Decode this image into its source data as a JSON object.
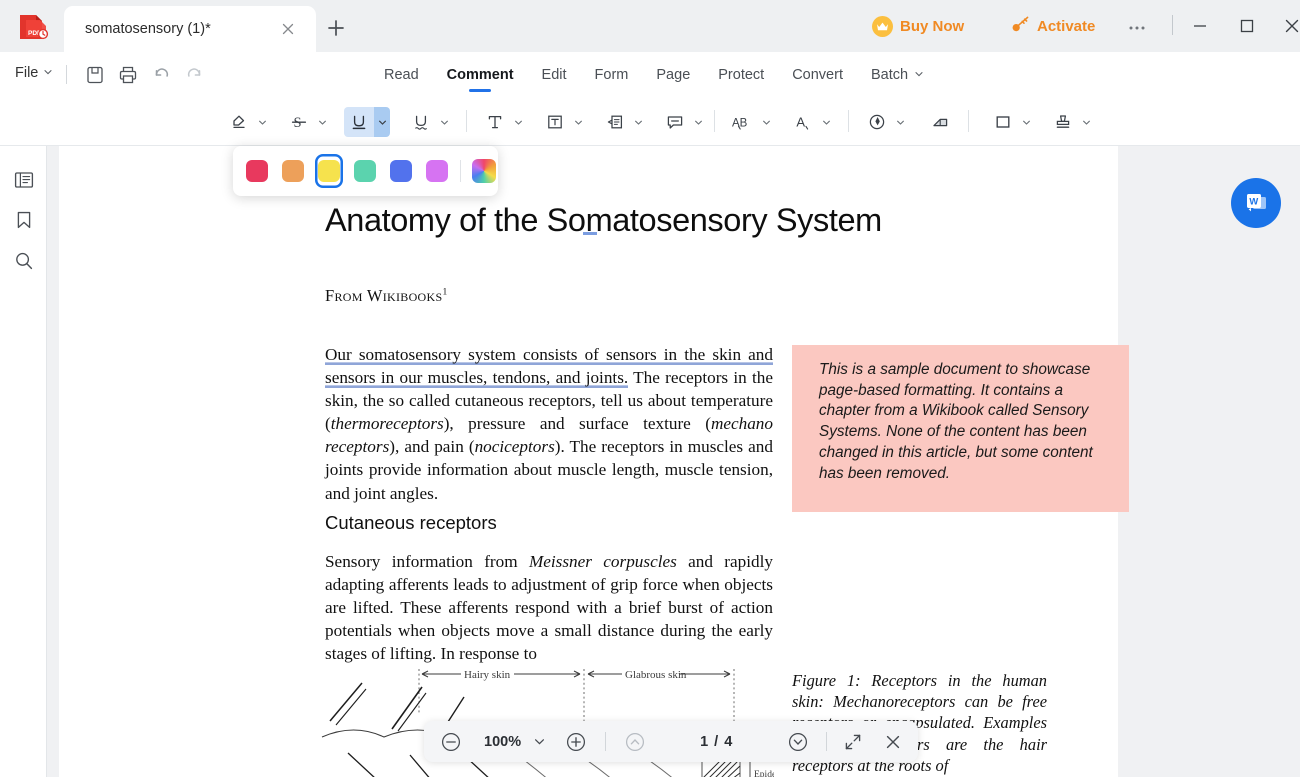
{
  "window": {
    "logo": "pdf-app-logo",
    "tab_title": "somatosensory (1)*",
    "close_tab_icon": "close-icon",
    "new_tab_icon": "plus-icon",
    "buy_now_label": "Buy Now",
    "buy_now_icon": "crown-icon",
    "activate_label": "Activate",
    "activate_icon": "key-icon",
    "more_icon": "ellipsis-icon",
    "minimize_icon": "minimize-icon",
    "maximize_icon": "maximize-icon",
    "close_icon": "close-icon",
    "accent_orange": "#f08a24",
    "accent_blue": "#2172e8"
  },
  "menubar": {
    "file_label": "File",
    "file_chevron": "chevron-down-icon",
    "quick_actions": [
      {
        "name": "save-icon",
        "title": "Save"
      },
      {
        "name": "print-icon",
        "title": "Print"
      },
      {
        "name": "undo-icon",
        "title": "Undo"
      },
      {
        "name": "redo-icon",
        "title": "Redo"
      }
    ],
    "tabs": [
      {
        "label": "Read",
        "active": false,
        "chevron": false
      },
      {
        "label": "Comment",
        "active": true,
        "chevron": false
      },
      {
        "label": "Edit",
        "active": false,
        "chevron": false
      },
      {
        "label": "Form",
        "active": false,
        "chevron": false
      },
      {
        "label": "Page",
        "active": false,
        "chevron": false
      },
      {
        "label": "Protect",
        "active": false,
        "chevron": false
      },
      {
        "label": "Convert",
        "active": false,
        "chevron": false
      },
      {
        "label": "Batch",
        "active": false,
        "chevron": true
      }
    ]
  },
  "toolbar": {
    "items": [
      {
        "name": "highlight-tool",
        "icon": "highlighter-icon",
        "chevron": true,
        "active": false
      },
      {
        "name": "strikethrough-tool",
        "icon": "strikethrough-icon",
        "chevron": true,
        "active": false
      },
      {
        "name": "underline-tool",
        "icon": "underline-icon",
        "chevron": true,
        "active": true
      },
      {
        "name": "squiggly-underline-tool",
        "icon": "squiggly-underline-icon",
        "chevron": true,
        "active": false
      },
      {
        "name": "text-tool",
        "icon": "text-T-icon",
        "chevron": true,
        "active": false
      },
      {
        "name": "text-box-tool",
        "icon": "text-box-icon",
        "chevron": true,
        "active": false
      },
      {
        "name": "callout-tool",
        "icon": "callout-icon",
        "chevron": true,
        "active": false
      },
      {
        "name": "note-tool",
        "icon": "sticky-note-icon",
        "chevron": true,
        "active": false
      },
      {
        "name": "replace-text-tool",
        "icon": "AB-replace-icon",
        "chevron": true,
        "active": false
      },
      {
        "name": "text-correction-tool",
        "icon": "A-correction-icon",
        "chevron": true,
        "active": false
      },
      {
        "name": "pencil-tool",
        "icon": "pen-circle-icon",
        "chevron": true,
        "active": false
      },
      {
        "name": "eraser-tool",
        "icon": "eraser-icon",
        "chevron": false,
        "active": false
      },
      {
        "name": "shape-tool",
        "icon": "rectangle-icon",
        "chevron": true,
        "active": false
      },
      {
        "name": "stamp-tool",
        "icon": "stamp-icon",
        "chevron": true,
        "active": false
      }
    ]
  },
  "color_popup": {
    "selected_index": 2,
    "swatches": [
      {
        "name": "color-red",
        "hex": "#e8395e"
      },
      {
        "name": "color-orange",
        "hex": "#eda05a"
      },
      {
        "name": "color-yellow",
        "hex": "#f6e24d"
      },
      {
        "name": "color-teal",
        "hex": "#5bd3ae"
      },
      {
        "name": "color-blue",
        "hex": "#5272ed"
      },
      {
        "name": "color-magenta",
        "hex": "#d673f2"
      }
    ],
    "more_colors_icon": "rainbow-color-picker-icon"
  },
  "left_rail": {
    "items": [
      {
        "name": "thumbnails-panel-icon",
        "title": "Thumbnails"
      },
      {
        "name": "bookmark-panel-icon",
        "title": "Bookmarks"
      },
      {
        "name": "search-panel-icon",
        "title": "Search"
      }
    ]
  },
  "document": {
    "title": "Anatomy of the Somatosensory System",
    "byline": "From Wikibooks",
    "byline_superscript": "1",
    "paragraph1_underlined": "Our somatosensory system consists of sensors in the skin and sensors in our muscles, tendons, and joints.",
    "paragraph1_rest_a": " The receptors in the skin, the so called cutaneous receptors, tell us about temperature (",
    "paragraph1_italic_a": "thermoreceptors",
    "paragraph1_rest_b": "), pressure and surface texture (",
    "paragraph1_italic_b": "mechano receptors",
    "paragraph1_rest_c": "), and pain (",
    "paragraph1_italic_c": "nociceptors",
    "paragraph1_rest_d": "). The receptors in muscles and joints provide information about muscle length, muscle tension, and joint angles.",
    "section_heading": "Cutaneous receptors",
    "paragraph2_underlined_a": "Sensory information from ",
    "paragraph2_underlined_italic": "Meissner corpuscles",
    "paragraph2_underlined_b": " and rapidly adapting afferents leads to adjustment of grip force when objects are lifted.",
    "paragraph2_rest": " These afferents respond with a brief burst of action potentials when objects move a small distance during the early stages of lifting. In response to",
    "note_text": "This is a sample document to showcase page-based formatting. It contains a chapter from a Wikibook called Sensory Systems. None of the content has been changed in this article, but some content has been removed.",
    "note_color": "#fbc8c1",
    "figure_caption": "Figure 1: Receptors in the human skin: Mechanoreceptors can be free receptors or encapsulated. Examples for free receptors are the hair receptors at the roots of",
    "figure_label_left": "Hairy skin",
    "figure_label_right": "Glabrous skin",
    "figure_label_epidermis": "Epidermis",
    "underline_blue_hex": "#8fa5d8",
    "underline_yellow_hex": "#e3d06a"
  },
  "fab": {
    "name": "convert-to-word-button",
    "icon": "word-document-icon",
    "letter": "W",
    "color": "#1a73e8"
  },
  "bottom_bar": {
    "zoom_out_icon": "zoom-out-icon",
    "zoom_level": "100%",
    "zoom_chevron_icon": "chevron-down-icon",
    "zoom_in_icon": "zoom-in-icon",
    "previous_page_icon": "chevron-up-circle-icon",
    "page_indicator": "1 / 4",
    "next_page_icon": "chevron-down-circle-icon",
    "fullscreen_icon": "expand-icon",
    "close_icon": "close-icon"
  }
}
